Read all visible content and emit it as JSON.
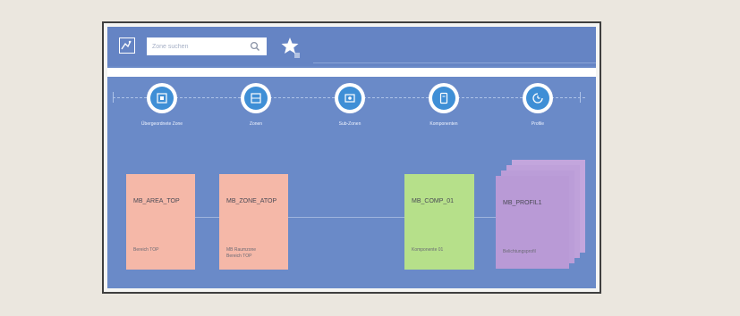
{
  "search": {
    "placeholder": "Zone suchen"
  },
  "steps": [
    {
      "label": "Übergeordnete Zone",
      "icon": "zone-icon"
    },
    {
      "label": "Zonen",
      "icon": "zone-icon"
    },
    {
      "label": "Sub-Zonen",
      "icon": "sub-zone-icon"
    },
    {
      "label": "Komponenten",
      "icon": "component-icon"
    },
    {
      "label": "Profile",
      "icon": "profile-icon"
    }
  ],
  "cards": [
    {
      "title": "MB_AREA_TOP",
      "description": "Bereich TOP",
      "color": "#f5b8a8"
    },
    {
      "title": "MB_ZONE_ATOP",
      "description": "MB Raumzone\nBereich TOP",
      "color": "#f5b8a8"
    },
    {
      "title": "MB_COMP_01",
      "description": "Komponente 01",
      "color": "#b6e08a"
    },
    {
      "title": "MB_PROFIL1",
      "description": "Belichtungsprofil",
      "color": "#b99ad6"
    }
  ],
  "colors": {
    "app_background": "#6a8ac8",
    "step_circle": "#3f8fd6",
    "page_background": "#ebe7df"
  }
}
